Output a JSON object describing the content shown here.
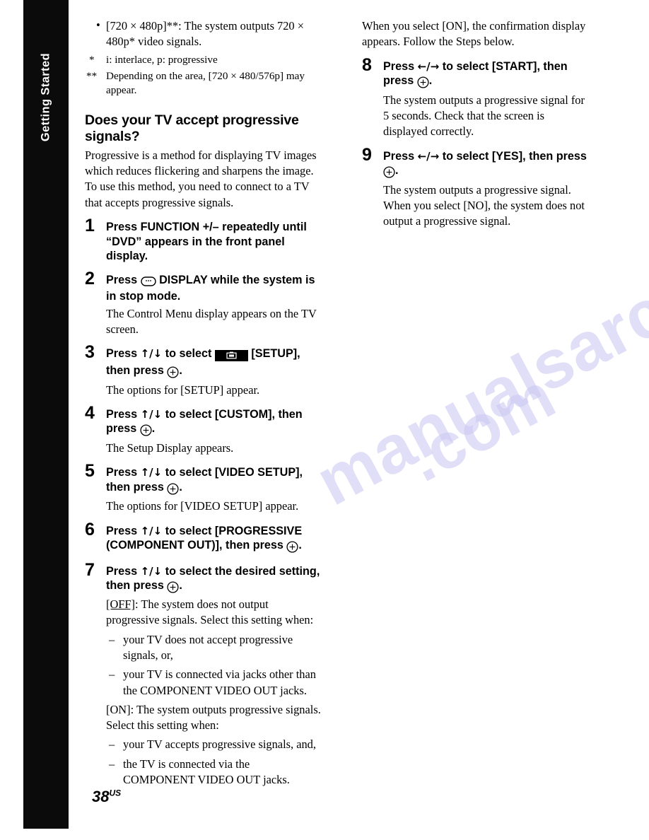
{
  "page": {
    "number": "38",
    "region_suffix": "US"
  },
  "side_tab": {
    "label": "Getting Started"
  },
  "watermark": {
    "line1": "manualsarchive",
    "line2": ".com"
  },
  "icons": {
    "enter": "enter-button-icon",
    "display": "display-button-icon",
    "setup": "setup-menu-icon",
    "up_down_arrows": "↑/↓",
    "left_right_arrows": "←/→"
  },
  "left_column": {
    "top_bullets": [
      {
        "marker": "•",
        "text": "[720 × 480p]**: The system outputs 720 × 480p* video signals."
      }
    ],
    "footnotes": [
      {
        "marker": "*",
        "text": "i: interlace, p: progressive"
      },
      {
        "marker": "**",
        "text": "Depending on the area, [720 × 480/576p] may appear."
      }
    ],
    "heading": "Does your TV accept progressive signals?",
    "intro": "Progressive is a method for displaying TV images which reduces flickering and sharpens the image. To use this method, you need to connect to a TV that accepts progressive signals.",
    "steps": [
      {
        "number": "1",
        "title_parts": [
          "Press FUNCTION +/– repeatedly until “DVD” appears in the front panel display."
        ],
        "body": ""
      },
      {
        "number": "2",
        "title_pre": "Press",
        "title_post": "DISPLAY while the system is in stop mode.",
        "body": "The Control Menu display appears on the TV screen."
      },
      {
        "number": "3",
        "title_pre": "Press",
        "title_mid": "to select",
        "title_post": "[SETUP], then press",
        "title_end": ".",
        "body": "The options for [SETUP] appear."
      },
      {
        "number": "4",
        "title_pre": "Press",
        "title_mid": "to select [CUSTOM], then press",
        "title_end": ".",
        "body": "The Setup Display appears."
      },
      {
        "number": "5",
        "title_pre": "Press",
        "title_mid": "to select [VIDEO SETUP], then press",
        "title_end": ".",
        "body": "The options for [VIDEO SETUP] appear."
      },
      {
        "number": "6",
        "title_pre": "Press",
        "title_mid": "to select [PROGRESSIVE (COMPONENT OUT)], then press",
        "title_end": ".",
        "body": ""
      },
      {
        "number": "7",
        "title_pre": "Press",
        "title_mid": "to select the desired setting, then press",
        "title_end": ".",
        "off_label": "[OFF]",
        "off_text": ": The system does not output progressive signals. Select this setting when:",
        "off_items": [
          "your TV does not accept progressive signals, or,",
          "your TV is connected via jacks other than the COMPONENT VIDEO OUT jacks."
        ],
        "on_text": "[ON]: The system outputs progressive signals. Select this setting when:",
        "on_items": [
          "your TV accepts progressive signals, and,",
          "the TV is connected via the COMPONENT VIDEO OUT jacks."
        ]
      }
    ]
  },
  "right_column": {
    "intro": "When you select [ON], the confirmation display appears. Follow the Steps below.",
    "steps": [
      {
        "number": "8",
        "title_pre": "Press",
        "title_mid": "to select [START], then press",
        "title_end": ".",
        "body": "The system outputs a progressive signal for 5 seconds. Check that the screen is displayed correctly."
      },
      {
        "number": "9",
        "title_pre": "Press",
        "title_mid": "to select [YES], then press",
        "title_end": ".",
        "body": "The system outputs a progressive signal. When you select [NO], the system does not output a progressive signal."
      }
    ]
  }
}
